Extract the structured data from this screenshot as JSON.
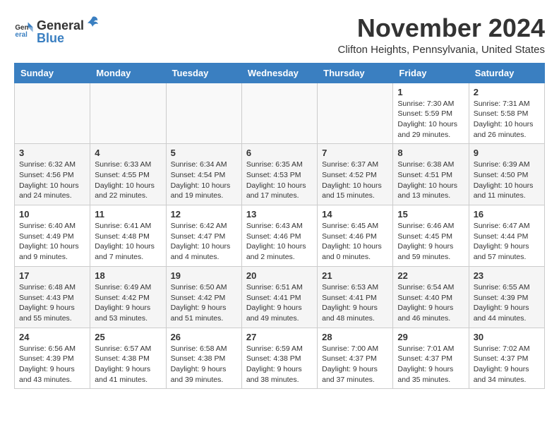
{
  "header": {
    "logo_general": "General",
    "logo_blue": "Blue",
    "month_title": "November 2024",
    "location": "Clifton Heights, Pennsylvania, United States"
  },
  "days_of_week": [
    "Sunday",
    "Monday",
    "Tuesday",
    "Wednesday",
    "Thursday",
    "Friday",
    "Saturday"
  ],
  "weeks": [
    [
      {
        "day": "",
        "info": ""
      },
      {
        "day": "",
        "info": ""
      },
      {
        "day": "",
        "info": ""
      },
      {
        "day": "",
        "info": ""
      },
      {
        "day": "",
        "info": ""
      },
      {
        "day": "1",
        "info": "Sunrise: 7:30 AM\nSunset: 5:59 PM\nDaylight: 10 hours and 29 minutes."
      },
      {
        "day": "2",
        "info": "Sunrise: 7:31 AM\nSunset: 5:58 PM\nDaylight: 10 hours and 26 minutes."
      }
    ],
    [
      {
        "day": "3",
        "info": "Sunrise: 6:32 AM\nSunset: 4:56 PM\nDaylight: 10 hours and 24 minutes."
      },
      {
        "day": "4",
        "info": "Sunrise: 6:33 AM\nSunset: 4:55 PM\nDaylight: 10 hours and 22 minutes."
      },
      {
        "day": "5",
        "info": "Sunrise: 6:34 AM\nSunset: 4:54 PM\nDaylight: 10 hours and 19 minutes."
      },
      {
        "day": "6",
        "info": "Sunrise: 6:35 AM\nSunset: 4:53 PM\nDaylight: 10 hours and 17 minutes."
      },
      {
        "day": "7",
        "info": "Sunrise: 6:37 AM\nSunset: 4:52 PM\nDaylight: 10 hours and 15 minutes."
      },
      {
        "day": "8",
        "info": "Sunrise: 6:38 AM\nSunset: 4:51 PM\nDaylight: 10 hours and 13 minutes."
      },
      {
        "day": "9",
        "info": "Sunrise: 6:39 AM\nSunset: 4:50 PM\nDaylight: 10 hours and 11 minutes."
      }
    ],
    [
      {
        "day": "10",
        "info": "Sunrise: 6:40 AM\nSunset: 4:49 PM\nDaylight: 10 hours and 9 minutes."
      },
      {
        "day": "11",
        "info": "Sunrise: 6:41 AM\nSunset: 4:48 PM\nDaylight: 10 hours and 7 minutes."
      },
      {
        "day": "12",
        "info": "Sunrise: 6:42 AM\nSunset: 4:47 PM\nDaylight: 10 hours and 4 minutes."
      },
      {
        "day": "13",
        "info": "Sunrise: 6:43 AM\nSunset: 4:46 PM\nDaylight: 10 hours and 2 minutes."
      },
      {
        "day": "14",
        "info": "Sunrise: 6:45 AM\nSunset: 4:46 PM\nDaylight: 10 hours and 0 minutes."
      },
      {
        "day": "15",
        "info": "Sunrise: 6:46 AM\nSunset: 4:45 PM\nDaylight: 9 hours and 59 minutes."
      },
      {
        "day": "16",
        "info": "Sunrise: 6:47 AM\nSunset: 4:44 PM\nDaylight: 9 hours and 57 minutes."
      }
    ],
    [
      {
        "day": "17",
        "info": "Sunrise: 6:48 AM\nSunset: 4:43 PM\nDaylight: 9 hours and 55 minutes."
      },
      {
        "day": "18",
        "info": "Sunrise: 6:49 AM\nSunset: 4:42 PM\nDaylight: 9 hours and 53 minutes."
      },
      {
        "day": "19",
        "info": "Sunrise: 6:50 AM\nSunset: 4:42 PM\nDaylight: 9 hours and 51 minutes."
      },
      {
        "day": "20",
        "info": "Sunrise: 6:51 AM\nSunset: 4:41 PM\nDaylight: 9 hours and 49 minutes."
      },
      {
        "day": "21",
        "info": "Sunrise: 6:53 AM\nSunset: 4:41 PM\nDaylight: 9 hours and 48 minutes."
      },
      {
        "day": "22",
        "info": "Sunrise: 6:54 AM\nSunset: 4:40 PM\nDaylight: 9 hours and 46 minutes."
      },
      {
        "day": "23",
        "info": "Sunrise: 6:55 AM\nSunset: 4:39 PM\nDaylight: 9 hours and 44 minutes."
      }
    ],
    [
      {
        "day": "24",
        "info": "Sunrise: 6:56 AM\nSunset: 4:39 PM\nDaylight: 9 hours and 43 minutes."
      },
      {
        "day": "25",
        "info": "Sunrise: 6:57 AM\nSunset: 4:38 PM\nDaylight: 9 hours and 41 minutes."
      },
      {
        "day": "26",
        "info": "Sunrise: 6:58 AM\nSunset: 4:38 PM\nDaylight: 9 hours and 39 minutes."
      },
      {
        "day": "27",
        "info": "Sunrise: 6:59 AM\nSunset: 4:38 PM\nDaylight: 9 hours and 38 minutes."
      },
      {
        "day": "28",
        "info": "Sunrise: 7:00 AM\nSunset: 4:37 PM\nDaylight: 9 hours and 37 minutes."
      },
      {
        "day": "29",
        "info": "Sunrise: 7:01 AM\nSunset: 4:37 PM\nDaylight: 9 hours and 35 minutes."
      },
      {
        "day": "30",
        "info": "Sunrise: 7:02 AM\nSunset: 4:37 PM\nDaylight: 9 hours and 34 minutes."
      }
    ]
  ]
}
